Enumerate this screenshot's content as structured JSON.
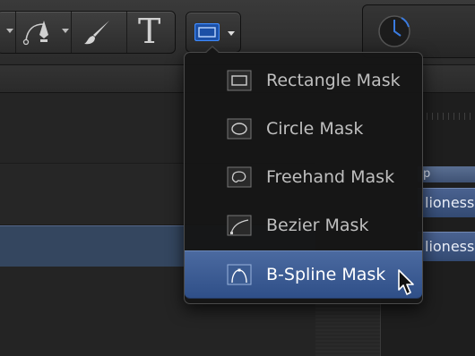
{
  "toolbar": {
    "tools": [
      {
        "icon": "bezier-pen-icon"
      },
      {
        "icon": "paintbrush-icon"
      },
      {
        "icon": "text-tool-icon",
        "glyph": "T"
      }
    ],
    "mask_button": {
      "icon": "rectangle-mask-icon",
      "dropdown": "chevron-down-icon"
    },
    "clock_icon": "clock-icon"
  },
  "mask_menu": {
    "items": [
      {
        "label": "Rectangle Mask",
        "icon": "rectangle-mask-icon",
        "selected": false
      },
      {
        "label": "Circle Mask",
        "icon": "circle-mask-icon",
        "selected": false
      },
      {
        "label": "Freehand Mask",
        "icon": "freehand-mask-icon",
        "selected": false
      },
      {
        "label": "Bezier Mask",
        "icon": "bezier-mask-icon",
        "selected": false
      },
      {
        "label": "B-Spline Mask",
        "icon": "bspline-mask-icon",
        "selected": true
      }
    ]
  },
  "layers": {
    "header": "p",
    "chips": [
      "lioness",
      "lioness"
    ]
  },
  "colors": {
    "selection": "#3d5d96",
    "accent_blue": "#2f6fd0",
    "clock_blue": "#3a7be0"
  }
}
